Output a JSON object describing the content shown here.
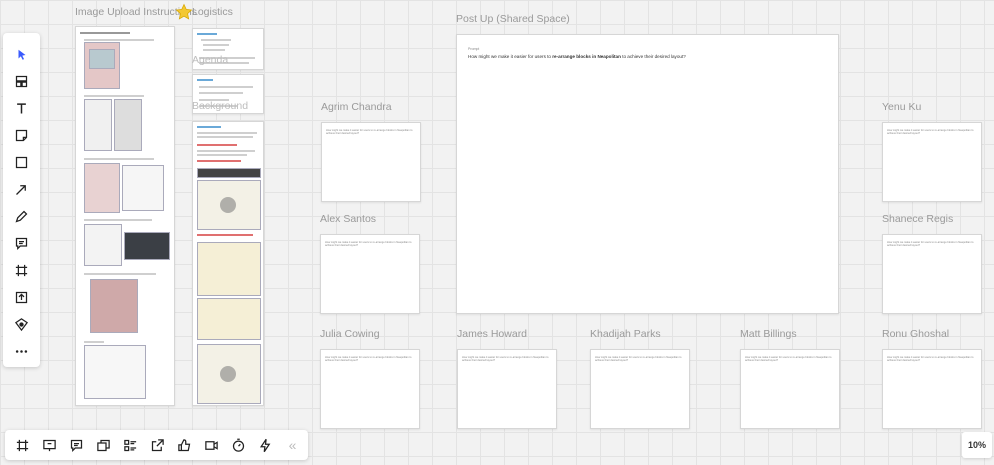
{
  "frames": {
    "image_upload": "Image Upload Instructions",
    "logistics": "Logistics",
    "agenda": "Agenda",
    "background": "Background",
    "post_up": "Post Up (Shared Space)"
  },
  "post_up_card": {
    "label": "Prompt",
    "question_prefix": "How might we make it easier for users to ",
    "question_bold": "re-arrange blocks in Neapolitan",
    "question_suffix": " to achieve their desired layout?"
  },
  "participants": [
    {
      "name": "Agrim Chandra"
    },
    {
      "name": "Alex Santos"
    },
    {
      "name": "Julia Cowing"
    },
    {
      "name": "James Howard"
    },
    {
      "name": "Khadijah Parks"
    },
    {
      "name": "Matt Billings"
    },
    {
      "name": "Yenu Ku"
    },
    {
      "name": "Shanece Regis"
    },
    {
      "name": "Ronu Ghoshal"
    }
  ],
  "card_prompt": "How might we make it easier for users to re-arrange blocks in Neapolitan to achieve their desired layout?",
  "left_tools": [
    "select-icon",
    "templates-icon",
    "text-icon",
    "sticky-note-icon",
    "shape-icon",
    "arrow-icon",
    "pen-icon",
    "comment-icon",
    "frame-icon",
    "upload-icon",
    "apps-icon",
    "more-icon"
  ],
  "bottom_tools": [
    "frames-icon",
    "present-icon",
    "comments-icon",
    "cards-icon",
    "kanban-icon",
    "share-icon",
    "reactions-icon",
    "video-icon",
    "timer-icon",
    "activity-icon",
    "collapse-icon"
  ],
  "collapse_glyph": "«",
  "zoom": "10%"
}
